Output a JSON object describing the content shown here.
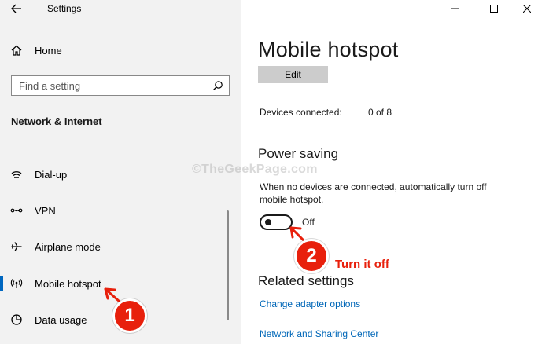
{
  "window": {
    "app_title": "Settings"
  },
  "sidebar": {
    "home_label": "Home",
    "search_placeholder": "Find a setting",
    "section_title": "Network & Internet",
    "items": [
      {
        "label": "Dial-up",
        "icon": "dial-up-icon"
      },
      {
        "label": "VPN",
        "icon": "vpn-icon"
      },
      {
        "label": "Airplane mode",
        "icon": "airplane-icon"
      },
      {
        "label": "Mobile hotspot",
        "icon": "hotspot-icon",
        "selected": true
      },
      {
        "label": "Data usage",
        "icon": "data-usage-icon"
      }
    ]
  },
  "main": {
    "page_title": "Mobile hotspot",
    "edit_label": "Edit",
    "devices_label": "Devices connected:",
    "devices_value": "0 of 8",
    "power_saving_title": "Power saving",
    "power_saving_desc": "When no devices are connected, automatically turn off mobile hotspot.",
    "toggle_state": "Off",
    "related_title": "Related settings",
    "links": [
      "Change adapter options",
      "Network and Sharing Center"
    ]
  },
  "annotations": {
    "watermark": "©TheGeekPage.com",
    "badge_1": "1",
    "badge_2": "2",
    "instruction": "Turn it off"
  },
  "colors": {
    "accent": "#0067c0",
    "link": "#0067b8",
    "annotation": "#e8200c",
    "sidebar_bg": "#f2f2f2"
  }
}
